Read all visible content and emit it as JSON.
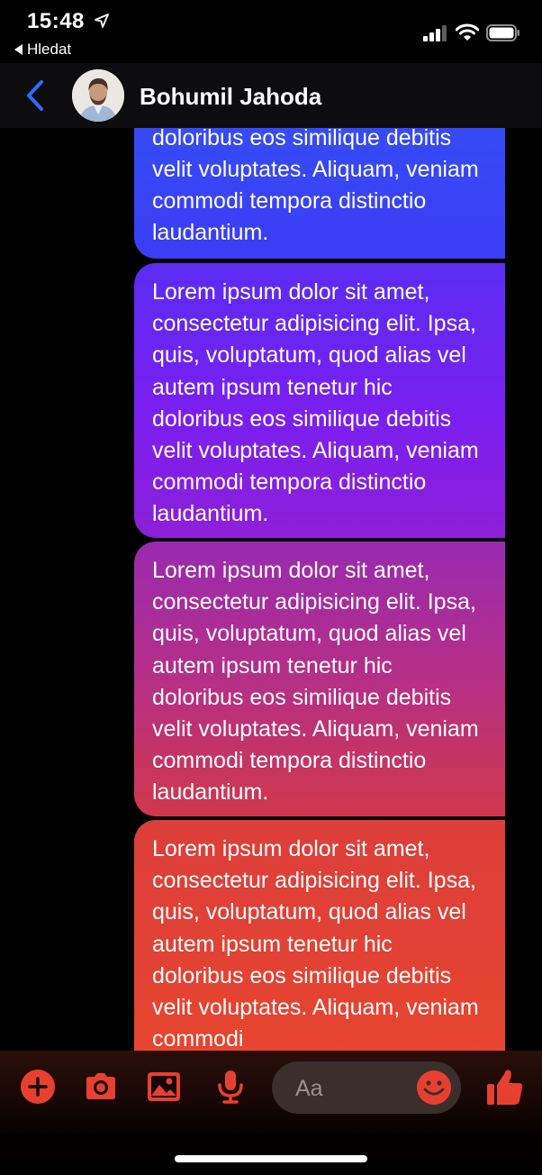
{
  "status": {
    "time": "15:48",
    "back_app_label": "Hledat"
  },
  "header": {
    "contact_name": "Bohumil Jahoda"
  },
  "messages": [
    {
      "text": "Lorem ipsum dolor sit amet, consectetur adipisicing elit. Ipsa, quis, voluptatum, quod alias vel autem ipsum tenetur hic doloribus eos similique debitis velit voluptates. Aliquam, veniam commodi tempora distinctio laudantium."
    },
    {
      "text": "Lorem ipsum dolor sit amet, consectetur adipisicing elit. Ipsa, quis, voluptatum, quod alias vel autem ipsum tenetur hic doloribus eos similique debitis velit voluptates. Aliquam, veniam commodi tempora distinctio laudantium."
    },
    {
      "text": "Lorem ipsum dolor sit amet, consectetur adipisicing elit. Ipsa, quis, voluptatum, quod alias vel autem ipsum tenetur hic doloribus eos similique debitis velit voluptates. Aliquam, veniam commodi tempora distinctio laudantium."
    },
    {
      "text": "Lorem ipsum dolor sit amet, consectetur adipisicing elit. Ipsa, quis, voluptatum, quod alias vel autem ipsum tenetur hic doloribus eos similique debitis velit voluptates. Aliquam, veniam commodi"
    }
  ],
  "composer": {
    "placeholder": "Aa",
    "icons": [
      "plus-icon",
      "camera-icon",
      "image-icon",
      "microphone-icon",
      "emoji-icon",
      "thumbs-up-icon"
    ]
  },
  "colors": {
    "accent": "#e8402f",
    "back_blue": "#2f6bff"
  }
}
